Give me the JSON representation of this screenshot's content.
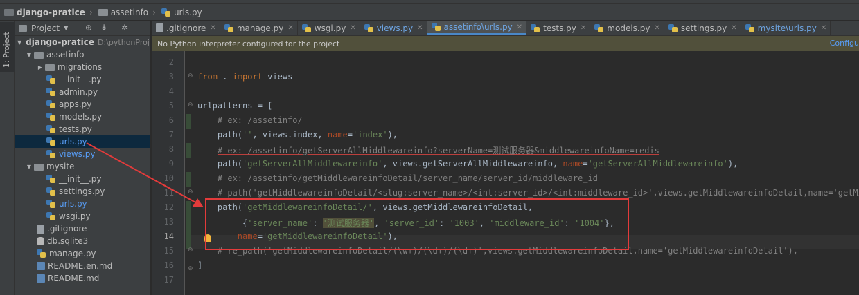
{
  "breadcrumb": {
    "project": "django-pratice",
    "folder": "assetinfo",
    "file": "urls.py"
  },
  "stripe": {
    "label": "1: Project"
  },
  "project_panel": {
    "title": "Project",
    "items": [
      {
        "label": "django-pratice",
        "path": "D:\\pythonProje",
        "kind": "project"
      },
      {
        "label": "assetinfo",
        "kind": "folder"
      },
      {
        "label": "migrations",
        "kind": "folder"
      },
      {
        "label": "__init__.py",
        "kind": "py"
      },
      {
        "label": "admin.py",
        "kind": "py"
      },
      {
        "label": "apps.py",
        "kind": "py"
      },
      {
        "label": "models.py",
        "kind": "py"
      },
      {
        "label": "tests.py",
        "kind": "py"
      },
      {
        "label": "urls.py",
        "kind": "py",
        "selected": true
      },
      {
        "label": "views.py",
        "kind": "py"
      },
      {
        "label": "mysite",
        "kind": "folder"
      },
      {
        "label": "__init__.py",
        "kind": "py"
      },
      {
        "label": "settings.py",
        "kind": "py"
      },
      {
        "label": "urls.py",
        "kind": "py"
      },
      {
        "label": "wsgi.py",
        "kind": "py"
      },
      {
        "label": ".gitignore",
        "kind": "file"
      },
      {
        "label": "db.sqlite3",
        "kind": "db"
      },
      {
        "label": "manage.py",
        "kind": "py"
      },
      {
        "label": "README.en.md",
        "kind": "md"
      },
      {
        "label": "README.md",
        "kind": "md"
      }
    ]
  },
  "tabs": [
    {
      "label": ".gitignore"
    },
    {
      "label": "manage.py"
    },
    {
      "label": "wsgi.py"
    },
    {
      "label": "views.py"
    },
    {
      "label": "assetinfo\\urls.py",
      "active": true
    },
    {
      "label": "tests.py"
    },
    {
      "label": "models.py"
    },
    {
      "label": "settings.py"
    },
    {
      "label": "mysite\\urls.py"
    }
  ],
  "banner": {
    "message": "No Python interpreter configured for the project",
    "action": "Configu"
  },
  "editor": {
    "line_numbers": [
      "2",
      "3",
      "4",
      "5",
      "6",
      "7",
      "8",
      "9",
      "10",
      "11",
      "12",
      "13",
      "14",
      "15",
      "16",
      "17"
    ],
    "current_line": "14",
    "lines": {
      "l3_kw1": "from",
      "l3_mid": " . ",
      "l3_kw2": "import",
      "l3_end": " views",
      "l5_a": "urlpatterns = [",
      "l6_c": "# ex: /",
      "l6_u": "assetinfo",
      "l6_e": "/",
      "l7_a": "path(",
      "l7_s": "''",
      "l7_b": ", views.index, ",
      "l7_p": "name",
      "l7_eq": "=",
      "l7_s2": "'index'",
      "l7_e": "),",
      "l8_c": "# ex: /assetinfo/getServerAllMiddlewareinfo?serverName=测试服务器&middlewareinfoName=redis",
      "l9_a": "path(",
      "l9_s": "'getServerAllMiddlewareinfo'",
      "l9_b": ", views.getServerAllMiddlewareinfo, ",
      "l9_p": "name",
      "l9_eq": "=",
      "l9_s2": "'getServerAllMiddlewareinfo'",
      "l9_e": "),",
      "l10_c": "# ex: /assetinfo/getMiddlewareinfoDetail/server_name/server_id/middleware_id",
      "l11_c": "# path('getMiddlewareinfoDetail/<slug:server_name>/<int:server_id>/<int:middleware_id>',views.getMiddlewareinfoDetail,name='getMiddlewareinfoDetail'),",
      "l12_a": "path(",
      "l12_s": "'getMiddlewareinfoDetail/'",
      "l12_b": ", views.getMiddlewareinfoDetail,",
      "l13_a": "{",
      "l13_k1": "'server_name'",
      "l13_c1": ": ",
      "l13_v1": "'测试服务器'",
      "l13_c2": ", ",
      "l13_k2": "'server_id'",
      "l13_c3": ": ",
      "l13_v2": "'1003'",
      "l13_c4": ", ",
      "l13_k3": "'middleware_id'",
      "l13_c5": ": ",
      "l13_v3": "'1004'",
      "l13_e": "},",
      "l14_p": "name",
      "l14_eq": "=",
      "l14_s": "'getMiddlewareinfoDetail'",
      "l14_e": "),",
      "l15_c": "# re_path('getMiddlewareinfoDetail/(\\w+)/(\\d+)/(\\d+)',views.getMiddlewareinfoDetail,name='getMiddlewareinfoDetail'),",
      "l16_a": "]"
    }
  },
  "colors": {
    "keyword": "#cc7832",
    "string": "#6a8759",
    "comment": "#808080",
    "param": "#aa4926",
    "annotation": "#e33b3b",
    "link": "#589df6"
  }
}
